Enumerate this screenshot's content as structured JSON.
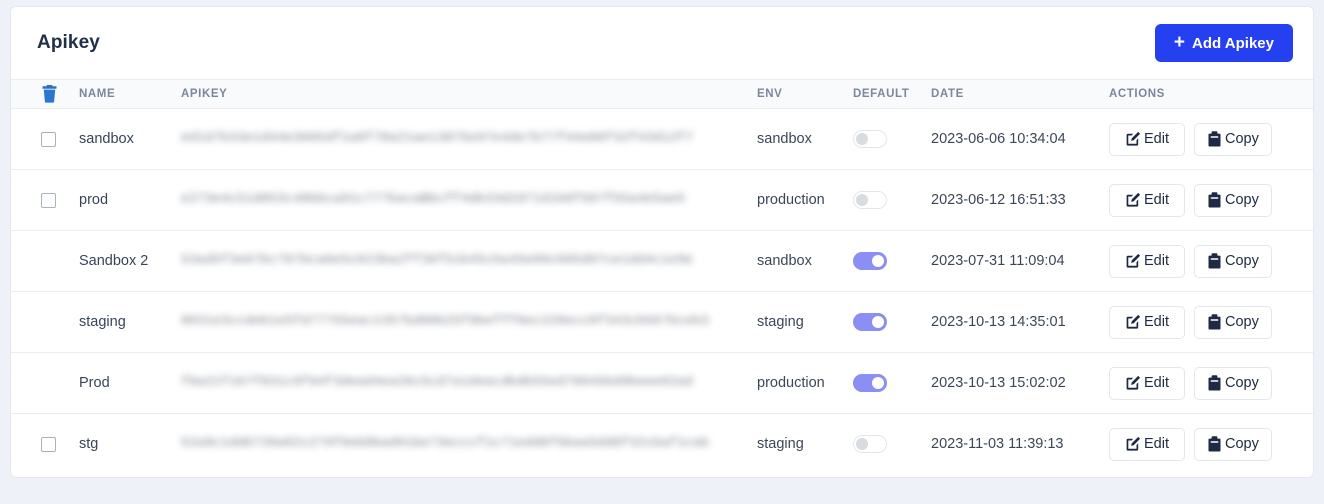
{
  "header": {
    "title": "Apikey",
    "add_button": {
      "label": "Add Apikey",
      "plus": "+"
    },
    "accent_color": "#2540f0"
  },
  "table": {
    "columns": {
      "select_icon": "trash-icon",
      "name": "NAME",
      "apikey": "APIKEY",
      "env": "ENV",
      "default": "DEFAULT",
      "date": "DATE",
      "actions": "ACTIONS"
    },
    "action_labels": {
      "edit": "Edit",
      "copy": "Copy"
    },
    "toggle_on_color": "#8b8ef2",
    "rows": [
      {
        "checkbox": true,
        "checked": false,
        "name": "sandbox",
        "apikey": "ed1d7b33e1d44e3605df1a8f78a21ae13875e97e4de7b77f44e88f32f43d12f7",
        "env": "sandbox",
        "default": false,
        "date": "2023-06-06 10:34:04"
      },
      {
        "checkbox": true,
        "checked": false,
        "name": "prod",
        "apikey": "e273e4c51d053c48bbca91c777bacaBbcff4db33d2d71d1b8f567f55a4e5ae5",
        "env": "production",
        "default": false,
        "date": "2023-06-12 16:51:33"
      },
      {
        "checkbox": false,
        "checked": false,
        "name": "Sandbox 2",
        "apikey": "53ad5f3e67bc787bca6e5c023ba2ff36f51b45c5a45e09c685d97ce1dd4c1e9e",
        "env": "sandbox",
        "default": true,
        "date": "2023-07-31 11:09:04"
      },
      {
        "checkbox": false,
        "checked": false,
        "name": "staging",
        "apikey": "8031e3ccdeb1e5fd77755eac1357bd88b25f9befff6ec228ecc0f343cb567bceb3",
        "env": "staging",
        "default": true,
        "date": "2023-10-13 14:35:01"
      },
      {
        "checkbox": false,
        "checked": false,
        "name": "Prod",
        "apikey": "f8a21f167f031c9f94f3dead4ea26c5cd7a1deacdbdb55ed78045bd9beee02ad",
        "env": "production",
        "default": true,
        "date": "2023-10-13 15:02:02"
      },
      {
        "checkbox": true,
        "checked": false,
        "name": "stg",
        "apikey": "52a9c1dd6739a02c279f0eb8bad91be73ecccf1c71edd6f5baa5dd8f32cbaf1cab",
        "env": "staging",
        "default": false,
        "date": "2023-11-03 11:39:13"
      }
    ]
  }
}
